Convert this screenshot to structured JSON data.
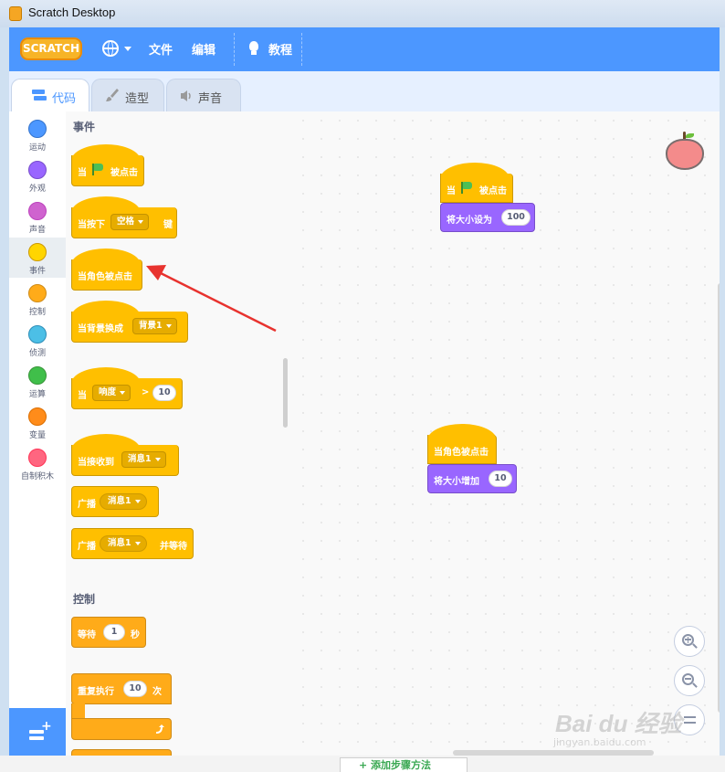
{
  "window": {
    "title": "Scratch Desktop"
  },
  "menubar": {
    "logo": "SCRATCH",
    "file": "文件",
    "edit": "编辑",
    "tutorials": "教程"
  },
  "tabs": [
    {
      "label": "代码",
      "active": true
    },
    {
      "label": "造型",
      "active": false
    },
    {
      "label": "声音",
      "active": false
    }
  ],
  "categories": [
    {
      "label": "运动",
      "color": "#4c97ff"
    },
    {
      "label": "外观",
      "color": "#9966ff"
    },
    {
      "label": "声音",
      "color": "#cf63cf"
    },
    {
      "label": "事件",
      "color": "#ffd500",
      "selected": true
    },
    {
      "label": "控制",
      "color": "#ffab19"
    },
    {
      "label": "侦测",
      "color": "#4cbfe6"
    },
    {
      "label": "运算",
      "color": "#40bf4a"
    },
    {
      "label": "变量",
      "color": "#ff8c1a"
    },
    {
      "label": "自制积木",
      "color": "#ff6680"
    }
  ],
  "palette": {
    "events_title": "事件",
    "control_title": "控制",
    "blocks": {
      "when_flag_a": "当",
      "when_flag_b": "被点击",
      "key_pressed_a": "当按下",
      "key_pressed_key": "空格",
      "key_pressed_b": "键",
      "sprite_clicked": "当角色被点击",
      "backdrop_switch": "当背景换成",
      "backdrop_name": "背景1",
      "when_a": "当",
      "loudness": "响度",
      "gt": ">",
      "loud_value": "10",
      "receive": "当接收到",
      "message1": "消息1",
      "broadcast": "广播",
      "broadcast_msg": "消息1",
      "broadcast_wait": "广播",
      "broadcast_wait_msg": "消息1",
      "and_wait": "并等待",
      "wait": "等待",
      "wait_value": "1",
      "seconds": "秒",
      "repeat": "重复执行",
      "repeat_value": "10",
      "times": "次"
    }
  },
  "script_area": {
    "script1": {
      "hat_a": "当",
      "hat_b": "被点击",
      "set_size": "将大小设为",
      "set_size_value": "100"
    },
    "script2": {
      "hat": "当角色被点击",
      "change_size": "将大小增加",
      "change_size_value": "10"
    }
  },
  "footer": {
    "add_method": "+ 添加步骤方法"
  },
  "watermark": {
    "brand": "Bai du 经验",
    "url": "jingyan.baidu.com"
  },
  "icons": [
    "globe-icon",
    "bulb-icon",
    "code-icon",
    "brush-icon",
    "speaker-icon",
    "flag-icon",
    "zoom-in-icon",
    "zoom-out-icon",
    "zoom-reset-icon",
    "extension-icon",
    "arrow-annotation",
    "apple-sprite"
  ]
}
